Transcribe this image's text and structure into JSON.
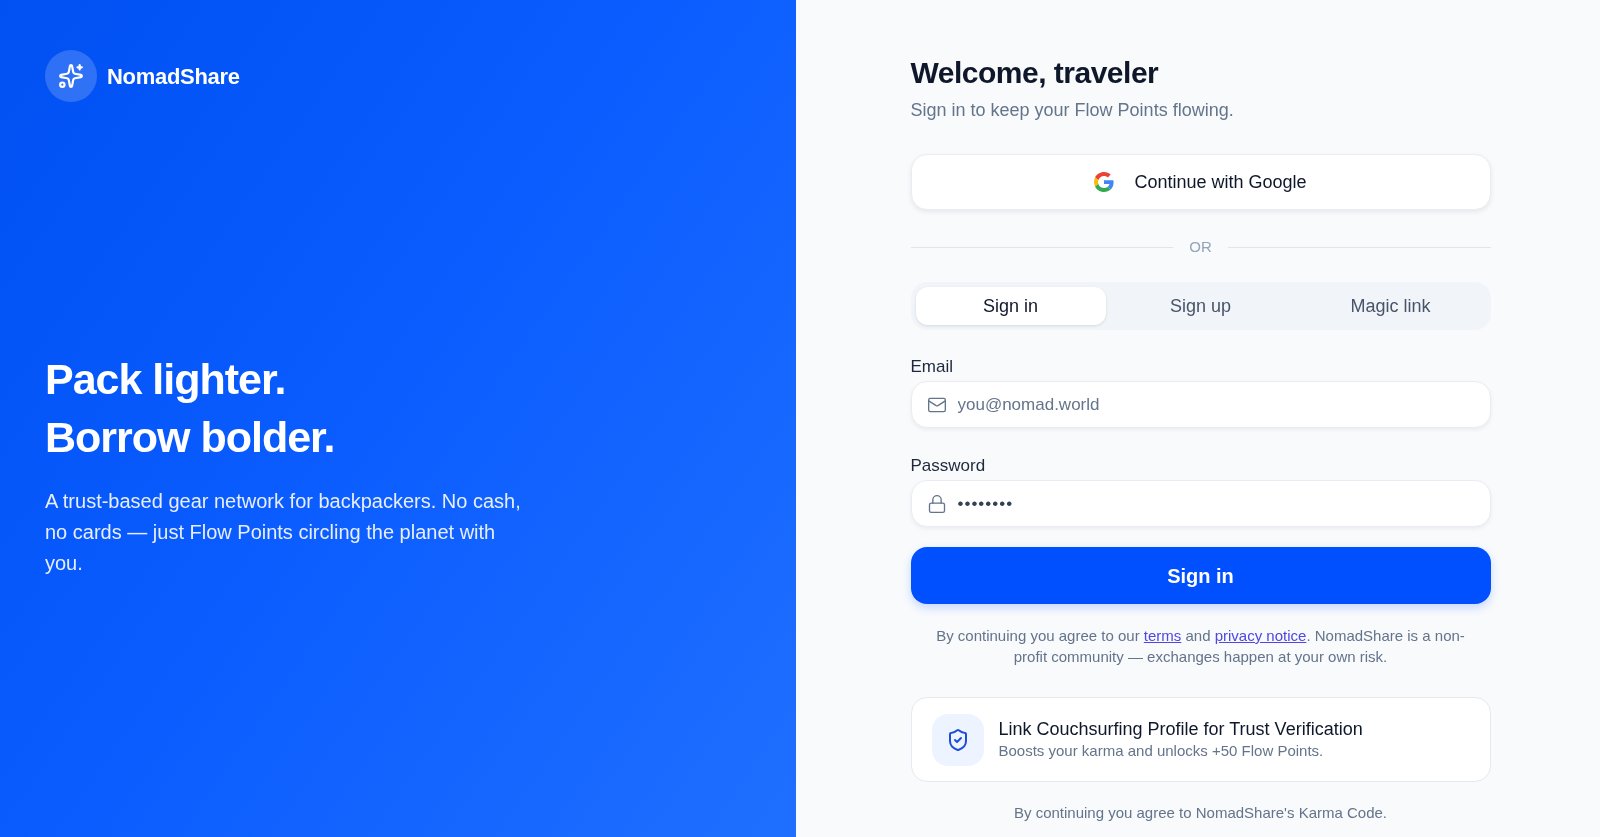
{
  "brand": {
    "name": "NomadShare"
  },
  "hero": {
    "headline_lines": [
      "Pack lighter.",
      "Borrow bolder."
    ],
    "description": "A trust-based gear network for backpackers. No cash, no cards — just Flow Points circling the planet with you."
  },
  "auth": {
    "title": "Welcome, traveler",
    "subtitle": "Sign in to keep your Flow Points flowing.",
    "google_button": "Continue with Google",
    "divider": "OR",
    "tabs": [
      {
        "label": "Sign in",
        "selected": true
      },
      {
        "label": "Sign up",
        "selected": false
      },
      {
        "label": "Magic link",
        "selected": false
      }
    ],
    "fields": [
      {
        "kind": "email",
        "label": "Email",
        "placeholder": "you@nomad.world"
      },
      {
        "kind": "password",
        "label": "Password",
        "value": "••••••••"
      }
    ],
    "submit_button": "Sign in",
    "legal": [
      {
        "kind": "text",
        "text": "By continuing you agree to our "
      },
      {
        "kind": "link",
        "text": "terms"
      },
      {
        "kind": "text",
        "text": " and "
      },
      {
        "kind": "link",
        "text": "privacy notice"
      },
      {
        "kind": "text",
        "text": ". NomadShare is a non-profit community — exchanges happen at your own risk."
      }
    ],
    "trust_card": {
      "title": "Link Couchsurfing Profile for Trust Verification",
      "subtitle": "Boosts your karma and unlocks +50 Flow Points."
    },
    "footer": "By continuing you agree to NomadShare's Karma Code."
  }
}
